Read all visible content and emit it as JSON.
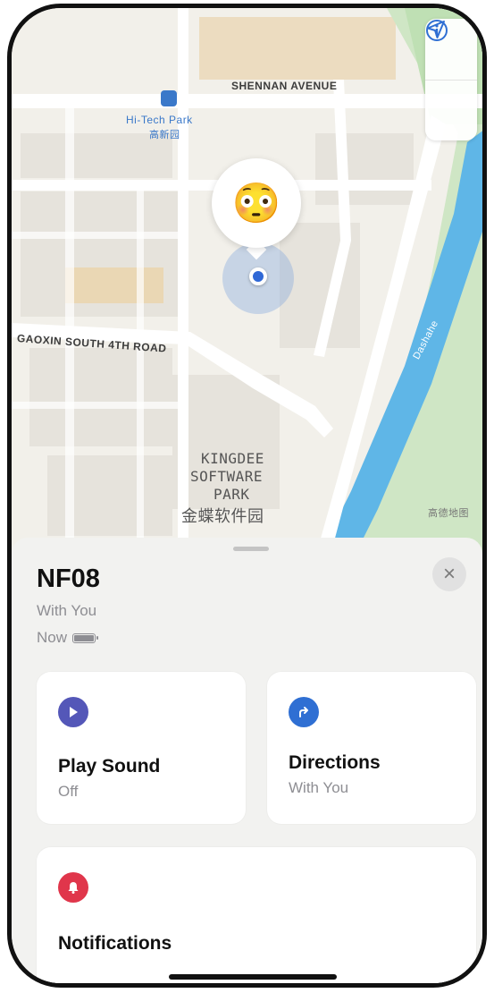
{
  "map": {
    "road_labels": {
      "shennan": "SHENNAN AVENUE",
      "gaoxin": "GAOXIN SOUTH 4TH ROAD",
      "dashahe": "Dashahe"
    },
    "station": {
      "name_en": "Hi-Tech Park",
      "name_zh": "高新园"
    },
    "park": {
      "line1": "KINGDEE",
      "line2": "SOFTWARE",
      "line3": "PARK",
      "name_zh": "金蝶软件园"
    },
    "watermark": "高德地图",
    "pin_emoji": "😳",
    "buttons": {
      "info_icon": "info-icon",
      "location_icon": "location-arrow-icon"
    }
  },
  "sheet": {
    "title": "NF08",
    "subtitle": "With You",
    "status": "Now",
    "close_icon": "close-icon",
    "cards": {
      "play_sound": {
        "label": "Play Sound",
        "sub": "Off",
        "color": "#5457b8"
      },
      "directions": {
        "label": "Directions",
        "sub": "With You",
        "color": "#2f6fd3"
      },
      "notifications": {
        "label": "Notifications",
        "color": "#e0364b"
      }
    }
  }
}
